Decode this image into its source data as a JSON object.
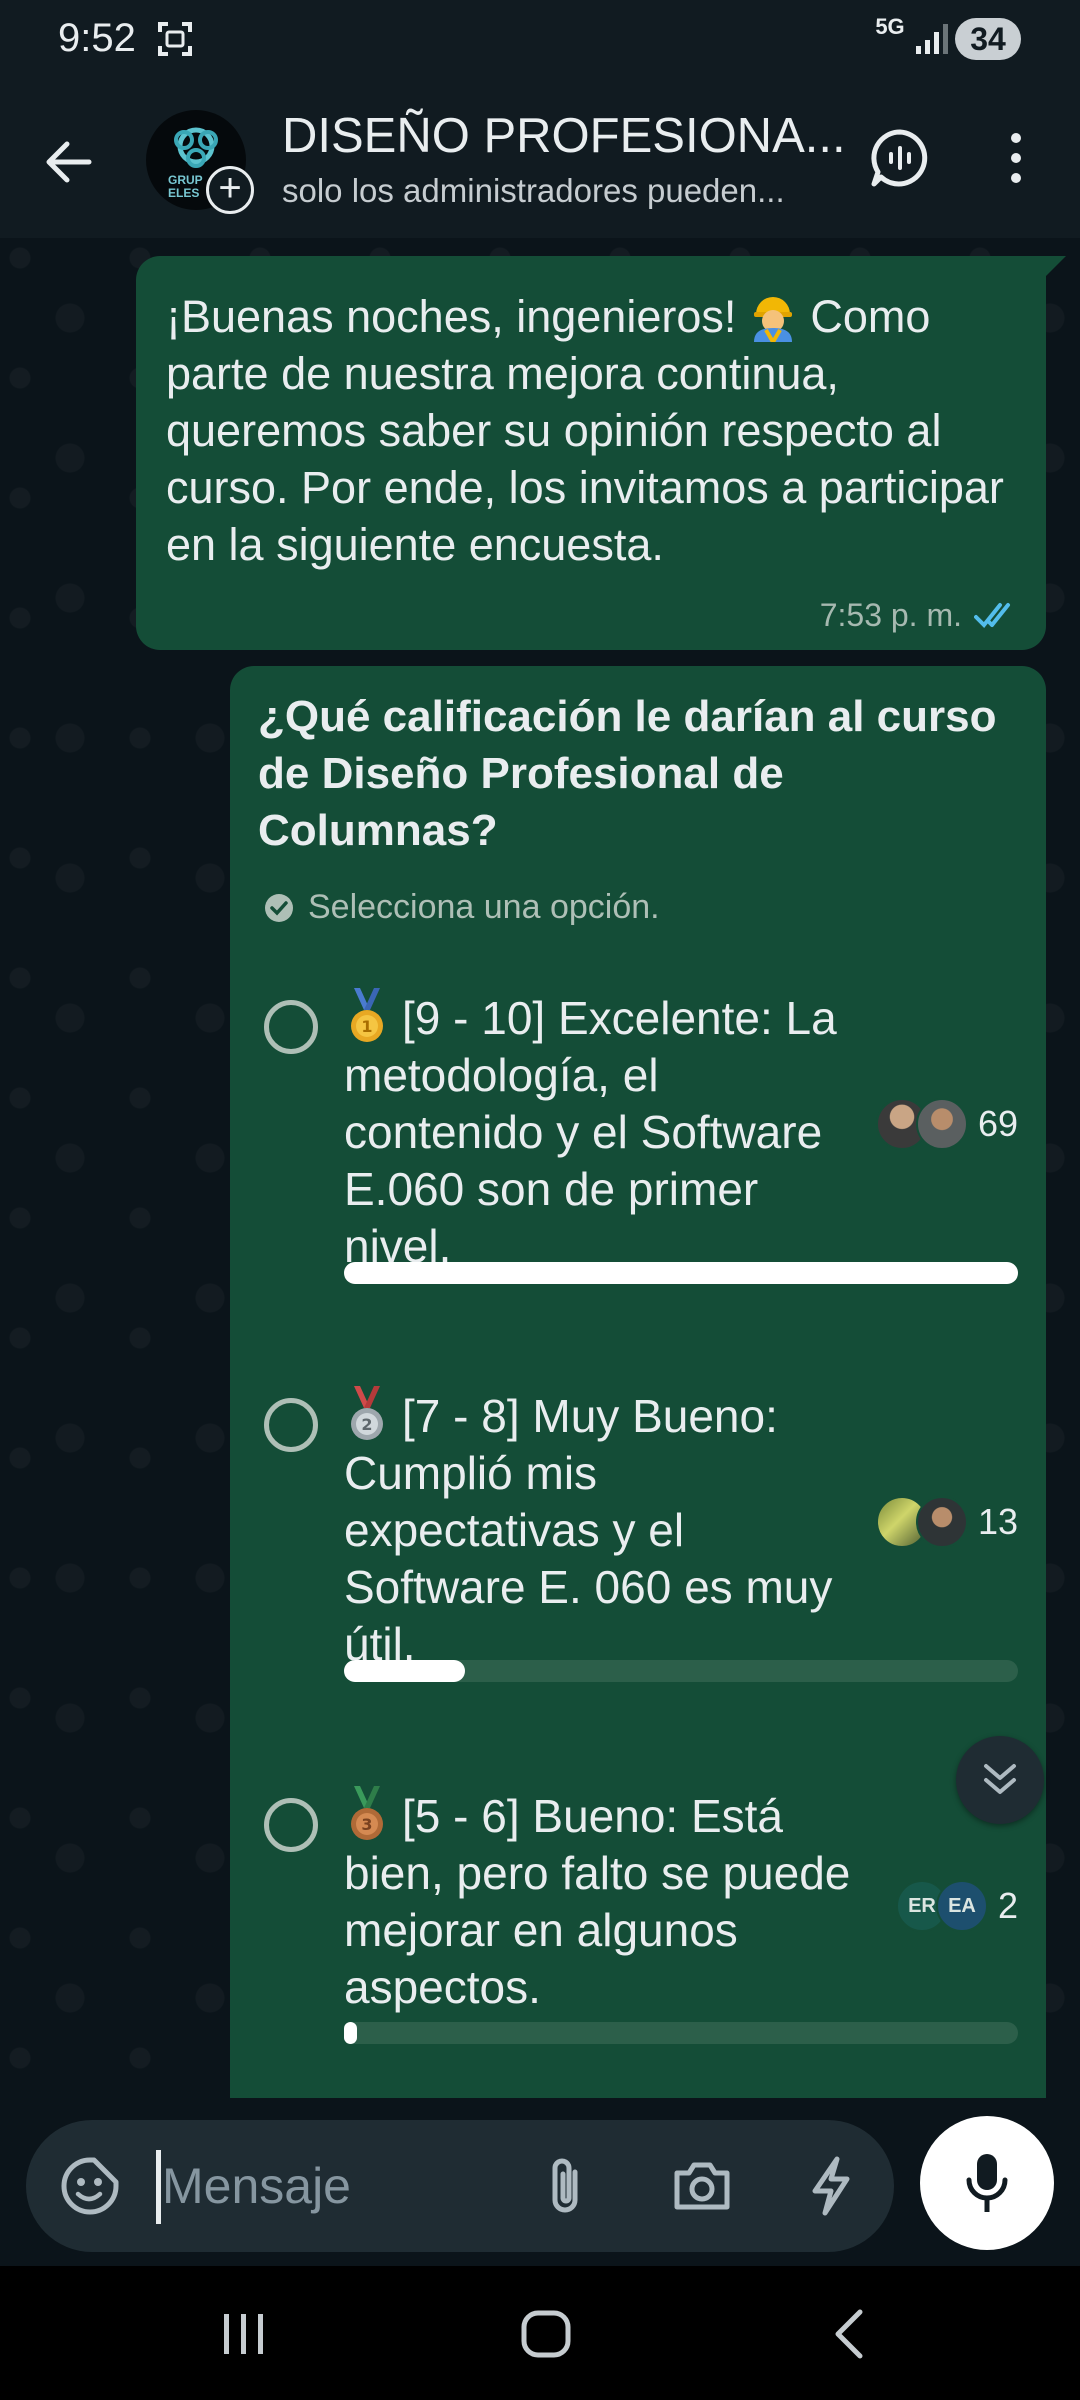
{
  "status_bar": {
    "time": "9:52",
    "network": "5G",
    "battery": "34"
  },
  "header": {
    "title": "DISEÑO PROFESIONA...",
    "subtitle": "solo los administradores pueden...",
    "avatar_text": "GRUP ELES"
  },
  "messages": [
    {
      "text_before_emoji": "¡Buenas noches, ingenieros!",
      "emoji": "construction-worker-icon",
      "text_after_emoji": "Como parte de nuestra mejora continua, queremos saber su opinión respecto al curso. Por ende, los invitamos a participar en la siguiente encuesta.",
      "time": "7:53 p. m.",
      "status": "read-double-check-icon"
    }
  ],
  "poll": {
    "question": "¿Qué calificación le darían al curso de Diseño Profesional de Columnas?",
    "hint": "Selecciona una opción.",
    "options": [
      {
        "medal": "gold-medal-icon",
        "label": "[9 - 10] Excelente: La metodología, el contenido y el Software E.060 son de primer nivel.",
        "votes": "69",
        "fraction": 1.0,
        "voter_initials": []
      },
      {
        "medal": "silver-medal-icon",
        "label": "[7 - 8] Muy Bueno: Cumplió mis expectativas y el Software E. 060 es muy útil.",
        "votes": "13",
        "fraction": 0.18,
        "voter_initials": []
      },
      {
        "medal": "bronze-medal-icon",
        "label": "[5 - 6] Bueno: Está bien, pero falto se puede mejorar en algunos aspectos.",
        "votes": "2",
        "fraction": 0.02,
        "voter_initials": [
          "ER",
          "EA"
        ]
      }
    ]
  },
  "composer": {
    "placeholder": "Mensaje"
  },
  "colors": {
    "bubble": "#144d37",
    "background": "#0b141a",
    "header": "#111b21",
    "read_tick": "#53bdeb"
  }
}
